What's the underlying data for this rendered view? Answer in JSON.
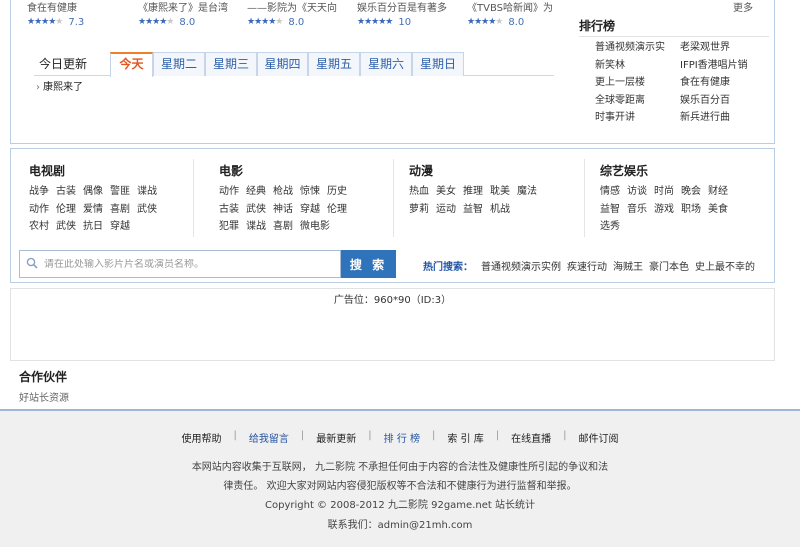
{
  "movies": [
    {
      "title": "食在有健康",
      "stars": 4,
      "score": "7.3"
    },
    {
      "title": "《康熙来了》是台湾",
      "stars": 4,
      "score": "8.0"
    },
    {
      "title": "——影院为《天天向",
      "stars": 4,
      "score": "8.0"
    },
    {
      "title": "娱乐百分百是有著多",
      "stars": 5,
      "score": "10"
    },
    {
      "title": "《TVBS哈新闻》为",
      "stars": 4,
      "score": "8.0"
    }
  ],
  "today": {
    "title": "今日更新",
    "tabs": [
      "今天",
      "星期二",
      "星期三",
      "星期四",
      "星期五",
      "星期六",
      "星期日"
    ],
    "active_tab": "今天",
    "items": [
      "康熙来了"
    ]
  },
  "rank": {
    "corner": "更多",
    "title": "排行榜",
    "items": [
      "普通视频演示实",
      "老梁观世界",
      "新笑林",
      "IFPI香港唱片销",
      "更上一层楼",
      "食在有健康",
      "全球零距离",
      "娱乐百分百",
      "时事开讲",
      "新兵进行曲"
    ]
  },
  "categories": [
    {
      "title": "电视剧",
      "links": [
        "战争",
        "古装",
        "偶像",
        "警匪",
        "谍战",
        "动作",
        "伦理",
        "爱情",
        "喜剧",
        "武侠",
        "农村",
        "武侠",
        "抗日",
        "穿越"
      ]
    },
    {
      "title": "电影",
      "links": [
        "动作",
        "经典",
        "枪战",
        "惊悚",
        "历史",
        "古装",
        "武侠",
        "神话",
        "穿越",
        "伦理",
        "犯罪",
        "谍战",
        "喜剧",
        "微电影"
      ]
    },
    {
      "title": "动漫",
      "links": [
        "热血",
        "美女",
        "推理",
        "耽美",
        "魔法",
        "萝莉",
        "运动",
        "益智",
        "机战"
      ]
    },
    {
      "title": "综艺娱乐",
      "links": [
        "情感",
        "访谈",
        "时尚",
        "晚会",
        "财经",
        "益智",
        "音乐",
        "游戏",
        "职场",
        "美食",
        "选秀"
      ]
    }
  ],
  "search": {
    "placeholder": "请在此处输入影片片名或演员名称。",
    "button": "搜 索",
    "hot_label": "热门搜索：",
    "hot_items": [
      "普通视频演示实例",
      "疾速行动",
      "海贼王",
      "豪门本色",
      "史上最不幸的"
    ]
  },
  "ad": {
    "text": "广告位：960*90（ID:3）"
  },
  "partners": {
    "title": "合作伙伴",
    "items": [
      "好站长资源"
    ]
  },
  "footer": {
    "nav": [
      "使用帮助",
      "给我留言",
      "最新更新",
      "排 行 榜",
      "索 引 库",
      "在线直播",
      "邮件订阅"
    ],
    "line1": "本网站内容收集于互联网， 九二影院 不承担任何由于内容的合法性及健康性所引起的争议和法",
    "line2": "律责任。 欢迎大家对网站内容侵犯版权等不合法和不健康行为进行监督和举报。",
    "copyright": "Copyright © 2008-2012 九二影院 92game.net 站长统计",
    "contact": "联系我们：admin@21mh.com"
  },
  "colors": {
    "accent": "#2f73ba",
    "active_tab": "#e4551b",
    "border": "#b9cde5",
    "footer_bg": "#f0f0f0"
  }
}
